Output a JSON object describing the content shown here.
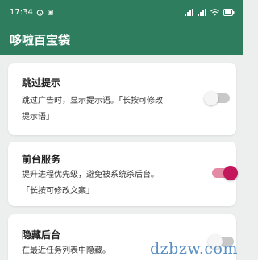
{
  "statusbar": {
    "time": "17:34",
    "left_icons": [
      "alarm-icon",
      "notification-icon"
    ],
    "right_icons": [
      "signal-1-icon",
      "signal-2-icon",
      "wifi-icon",
      "battery-icon"
    ]
  },
  "appbar": {
    "title": "哆啦百宝袋"
  },
  "settings": [
    {
      "title": "跳过提示",
      "desc_line1": "跳过广告时，显示提示语。「长按可修改",
      "desc_line2": "提示语」",
      "enabled": false
    },
    {
      "title": "前台服务",
      "desc_line1": "提升进程优先级，避免被系统杀后台。",
      "desc_line2": "「长按可修改文案」",
      "enabled": true
    },
    {
      "title": "隐藏后台",
      "desc_line1": "在最近任务列表中隐藏。",
      "enabled": false
    }
  ],
  "watermark": {
    "text": "dzbzw.com"
  },
  "colors": {
    "primary": "#2e7d5e",
    "switch_on": "#c2185b",
    "background": "#ecefee"
  }
}
